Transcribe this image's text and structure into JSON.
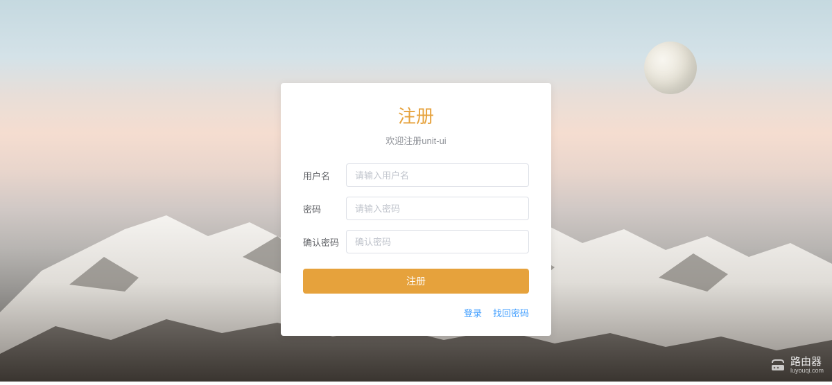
{
  "card": {
    "title": "注册",
    "subtitle": "欢迎注册unit-ui",
    "fields": {
      "username": {
        "label": "用户名",
        "placeholder": "请输入用户名"
      },
      "password": {
        "label": "密码",
        "placeholder": "请输入密码"
      },
      "confirm_password": {
        "label": "确认密码",
        "placeholder": "确认密码"
      }
    },
    "submit_label": "注册",
    "links": {
      "login": "登录",
      "forgot": "找回密码"
    }
  },
  "watermark": {
    "title": "路由器",
    "url": "luyouqi.com"
  },
  "colors": {
    "accent": "#e6a23c",
    "link": "#409eff"
  }
}
